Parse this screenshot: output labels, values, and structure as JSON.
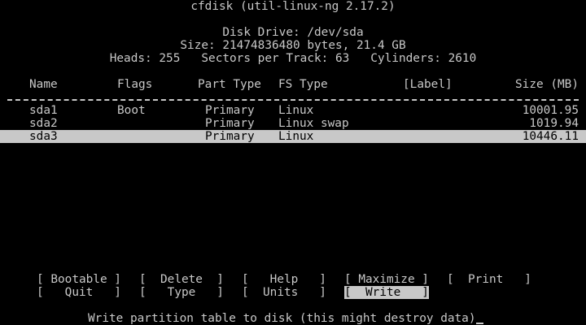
{
  "header": {
    "title": "cfdisk (util-linux-ng 2.17.2)",
    "drive": "Disk Drive: /dev/sda",
    "size": "Size: 21474836480 bytes, 21.4 GB",
    "geometry": "Heads: 255   Sectors per Track: 63   Cylinders: 2610"
  },
  "table": {
    "columns": {
      "name": "Name",
      "flags": "Flags",
      "part_type": "Part Type",
      "fs_type": "FS Type",
      "label": "[Label]",
      "size": "Size (MB)"
    },
    "rows": [
      {
        "name": "sda1",
        "flags": "Boot",
        "part_type": "Primary",
        "fs_type": "Linux",
        "label": "",
        "size": "10001.95",
        "selected": false
      },
      {
        "name": "sda2",
        "flags": "",
        "part_type": "Primary",
        "fs_type": "Linux swap",
        "label": "",
        "size": "1019.94",
        "selected": false
      },
      {
        "name": "sda3",
        "flags": "",
        "part_type": "Primary",
        "fs_type": "Linux",
        "label": "",
        "size": "10446.11",
        "selected": true
      }
    ]
  },
  "menu": {
    "bootable": "[ Bootable ]",
    "delete": "[  Delete  ]",
    "help": "[   Help   ]",
    "maximize": "[ Maximize ]",
    "print": "[  Print   ]",
    "quit": "[   Quit   ]",
    "type": "[   Type   ]",
    "units": "[  Units   ]",
    "write": "[  Write   ]",
    "selected": "write"
  },
  "status": {
    "message": "Write partition table to disk (this might destroy data)"
  }
}
